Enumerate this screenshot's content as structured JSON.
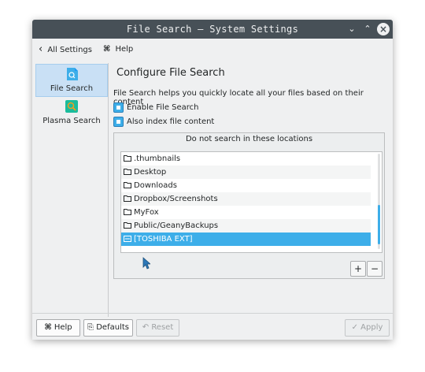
{
  "window": {
    "title": "File Search — System Settings"
  },
  "toolbar": {
    "back_label": "All Settings",
    "help_label": "Help"
  },
  "sidebar": {
    "items": [
      {
        "label": "File Search",
        "icon": "file-search-icon",
        "active": true
      },
      {
        "label": "Plasma Search",
        "icon": "plasma-search-icon",
        "active": false
      }
    ]
  },
  "main": {
    "heading": "Configure File Search",
    "description": "File Search helps you quickly locate all your files based on their content",
    "options": [
      {
        "label": "Enable File Search",
        "checked": true
      },
      {
        "label": "Also index file content",
        "checked": true
      }
    ],
    "exclude_caption": "Do not search in these locations",
    "locations": [
      ".thumbnails",
      "Desktop",
      "Downloads",
      "Dropbox/Screenshots",
      "MyFox",
      "Public/GeanyBackups",
      "[TOSHIBA EXT]"
    ],
    "selected_location": "[TOSHIBA EXT]",
    "add_label": "+",
    "remove_label": "−"
  },
  "buttons": {
    "help": "Help",
    "defaults": "Defaults",
    "reset": "Reset",
    "apply": "Apply"
  },
  "colors": {
    "titlebar": "#475057",
    "accent": "#3daee9",
    "window_bg": "#eff0f1"
  }
}
